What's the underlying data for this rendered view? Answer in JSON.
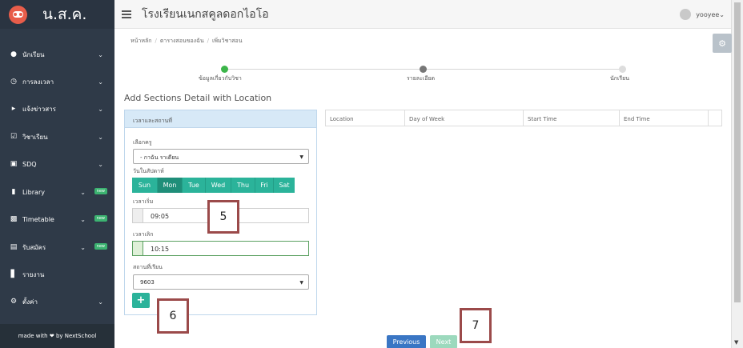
{
  "sidebar": {
    "brand": "น.ส.ค.",
    "items": [
      {
        "label": "นักเรียน",
        "icon": "users-icon",
        "badge": ""
      },
      {
        "label": "การลงเวลา",
        "icon": "clock-icon",
        "badge": ""
      },
      {
        "label": "แจ้งข่าวสาร",
        "icon": "megaphone-icon",
        "badge": ""
      },
      {
        "label": "วิชาเรียน",
        "icon": "calendar-check-icon",
        "badge": ""
      },
      {
        "label": "SDQ",
        "icon": "clipboard-icon",
        "badge": ""
      },
      {
        "label": "Library",
        "icon": "book-icon",
        "badge": "new"
      },
      {
        "label": "Timetable",
        "icon": "table-icon",
        "badge": "new"
      },
      {
        "label": "รับสมัคร",
        "icon": "form-icon",
        "badge": "new"
      },
      {
        "label": "รายงาน",
        "icon": "bar-chart-icon",
        "badge": ""
      },
      {
        "label": "ตั้งค่า",
        "icon": "gears-icon",
        "badge": ""
      }
    ],
    "footer": "made with ❤ by NextSchool"
  },
  "topbar": {
    "school_name": "โรงเรียนเนกสคูลดอกไอโอ",
    "username": "yooyee"
  },
  "breadcrumb": [
    "หน้าหลัก",
    "ตารางสอนของฉัน",
    "เพิ่มวิชาสอน"
  ],
  "wizard": {
    "steps": [
      "ข้อมูลเกี่ยวกับวิชา",
      "รายละเอียด",
      "นักเรียน"
    ],
    "current_step": 1
  },
  "heading": "Add Sections Detail with Location",
  "form": {
    "panel_title": "เวลาและสถานที่",
    "teacher_label": "เลือกครู",
    "teacher_value": "- กาฉัน ราเดียน",
    "days_label": "วันในสัปดาห์",
    "days": [
      "Sun",
      "Mon",
      "Tue",
      "Wed",
      "Thu",
      "Fri",
      "Sat"
    ],
    "selected_day": "Mon",
    "start_label": "เวลาเริ่ม",
    "start_value": "09:05",
    "end_label": "เวลาเลิก",
    "end_value": "10:15",
    "room_label": "สถานที่เรียน",
    "room_value": "9603",
    "add_label": "+"
  },
  "table": {
    "columns": [
      "Location",
      "Day of Week",
      "Start Time",
      "End Time",
      ""
    ]
  },
  "buttons": {
    "previous": "Previous",
    "next": "Next"
  },
  "callouts": [
    "5",
    "6",
    "7"
  ],
  "colors": {
    "sidebar": "#2f3a48",
    "accent": "#2bb39a",
    "step_active": "#3cb54a",
    "primary": "#3a76c4",
    "callout_border": "#9b4a4a"
  }
}
